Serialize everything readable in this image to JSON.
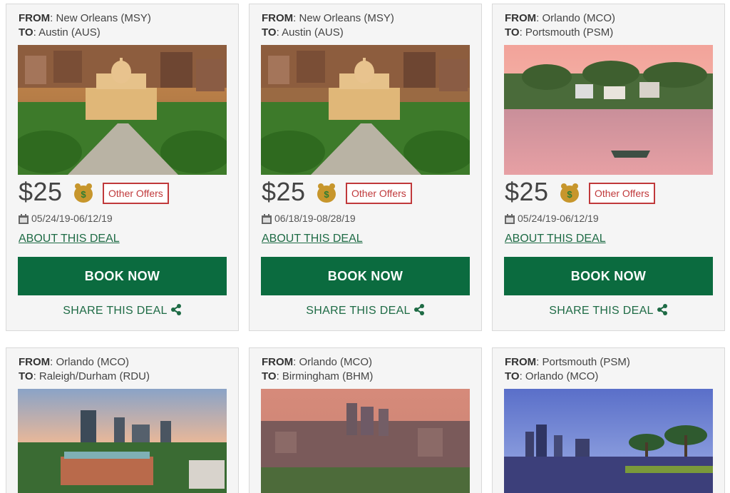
{
  "labels": {
    "from": "FROM",
    "to": "TO",
    "currency_symbol": "$",
    "other_offers": "Other Offers",
    "about": "ABOUT THIS DEAL",
    "book": "BOOK NOW",
    "share": "SHARE THIS DEAL"
  },
  "colors": {
    "accent_green": "#0b6b3f",
    "link_green": "#1e6b45",
    "offers_red": "#c0393b",
    "card_bg": "#f5f5f5"
  },
  "icons": {
    "calendar": "calendar-icon",
    "mascot": "dollar-mascot-icon",
    "share": "share-icon"
  },
  "deals": [
    {
      "from": "New Orleans (MSY)",
      "to": "Austin (AUS)",
      "price": "25",
      "dates": "05/24/19-06/12/19",
      "image": "austin-capitol-photo"
    },
    {
      "from": "New Orleans (MSY)",
      "to": "Austin (AUS)",
      "price": "25",
      "dates": "06/18/19-08/28/19",
      "image": "austin-capitol-photo"
    },
    {
      "from": "Orlando (MCO)",
      "to": "Portsmouth (PSM)",
      "price": "25",
      "dates": "05/24/19-06/12/19",
      "image": "portsmouth-harbor-photo"
    },
    {
      "from": "Orlando (MCO)",
      "to": "Raleigh/Durham (RDU)",
      "image": "raleigh-skyline-photo"
    },
    {
      "from": "Orlando (MCO)",
      "to": "Birmingham (BHM)",
      "image": "birmingham-skyline-photo"
    },
    {
      "from": "Portsmouth (PSM)",
      "to": "Orlando (MCO)",
      "image": "orlando-lake-photo"
    }
  ]
}
